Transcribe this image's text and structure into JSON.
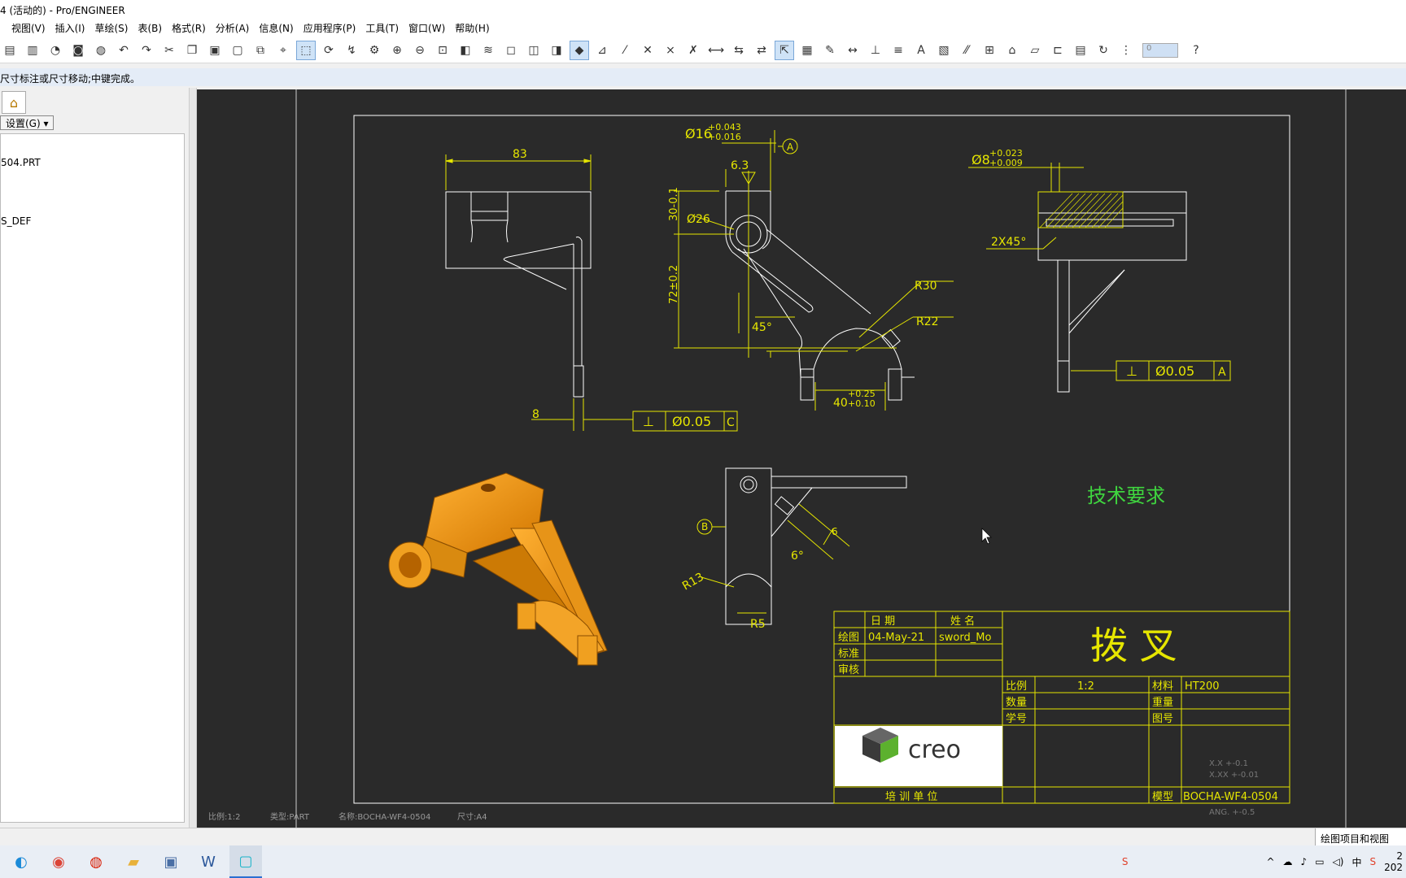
{
  "window": {
    "title": "4 (活动的) - Pro/ENGINEER"
  },
  "menu": [
    "视图(V)",
    "插入(I)",
    "草绘(S)",
    "表(B)",
    "格式(R)",
    "分析(A)",
    "信息(N)",
    "应用程序(P)",
    "工具(T)",
    "窗口(W)",
    "帮助(H)"
  ],
  "toolbar": {
    "spinner_value": "0"
  },
  "status_message": "尺寸标注或尺寸移动;中键完成。",
  "left_panel": {
    "settings_label": "设置(G)",
    "tree_items": [
      "504.PRT",
      "S_DEF"
    ]
  },
  "drawing": {
    "dims": {
      "d83": "83",
      "d16": "Ø16",
      "d16_tol_u": "+0.043",
      "d16_tol_l": "+0.016",
      "d63": "6.3",
      "d30": "30-0.1",
      "d26": "Ø26",
      "d72": "72±0.2",
      "d45": "45°",
      "r30": "R30",
      "r22": "R22",
      "d40": "40",
      "d40_tol_u": "+0.25",
      "d40_tol_l": "+0.10",
      "d8": "8",
      "d8phi": "Ø8",
      "d8_tol_u": "+0.023",
      "d8_tol_l": "+0.009",
      "chamfer": "2X45°",
      "r13": "R13",
      "r5": "R5",
      "d6deg": "6°",
      "d6": "6"
    },
    "datum_a": "A",
    "datum_b": "B",
    "fcf_c": {
      "sym": "⊥",
      "val": "Ø0.05",
      "datum": "C"
    },
    "fcf_a": {
      "sym": "⊥",
      "val": "Ø0.05",
      "datum": "A"
    },
    "tech_req": "技术要求",
    "title_block": {
      "h_date": "日 期",
      "h_name": "姓 名",
      "r_draw": "绘图",
      "r_date": "04-May-21",
      "r_author": "sword_Mo",
      "r_std": "标准",
      "r_check": "审核",
      "part_name": "拨    叉",
      "scale_label": "比例",
      "scale": "1:2",
      "material_label": "材料",
      "material": "HT200",
      "qty_label": "数量",
      "weight_label": "重量",
      "no_label": "学号",
      "dwg_label": "图号",
      "model_label": "模型",
      "model": "BOCHA-WF4-0504",
      "org": "培 训 单 位",
      "tol1": "X.X   +-0.1",
      "tol2": "X.XX  +-0.01",
      "tol3": "ANG.  +-0.5",
      "logo_text": "creo"
    },
    "footer": {
      "scale": "比例:1:2",
      "type": "类型:PART",
      "name": "名称:BOCHA-WF4-0504",
      "size": "尺寸:A4"
    }
  },
  "bottom_status": {
    "mode": "绘图项目和视图"
  },
  "taskbar": {
    "ime": "中",
    "time": "2",
    "date": "202"
  }
}
